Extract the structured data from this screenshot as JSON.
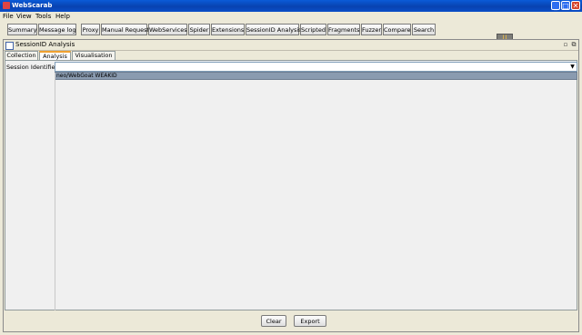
{
  "window": {
    "title": "WebScarab",
    "minimize": "_",
    "maximize": "□",
    "close": "✕"
  },
  "menu": [
    "File",
    "View",
    "Tools",
    "Help"
  ],
  "toolbar": [
    "Summary",
    "Message log",
    "Proxy",
    "Manual Request",
    "WebServices",
    "Spider",
    "Extensions",
    "SessionID Analysis",
    "Scripted",
    "Fragments",
    "Fuzzer",
    "Compare",
    "Search"
  ],
  "frame": {
    "title": "SessionID Analysis",
    "restore": "▫",
    "popout": "⧉"
  },
  "tabs": [
    "Collection",
    "Analysis",
    "Visualisation"
  ],
  "analysis": {
    "session_label": "Session Identifier :",
    "selected_value": "",
    "options": [
      "neo/WebGoat WEAKID"
    ]
  },
  "buttons": {
    "clear": "Clear",
    "export": "Export"
  }
}
